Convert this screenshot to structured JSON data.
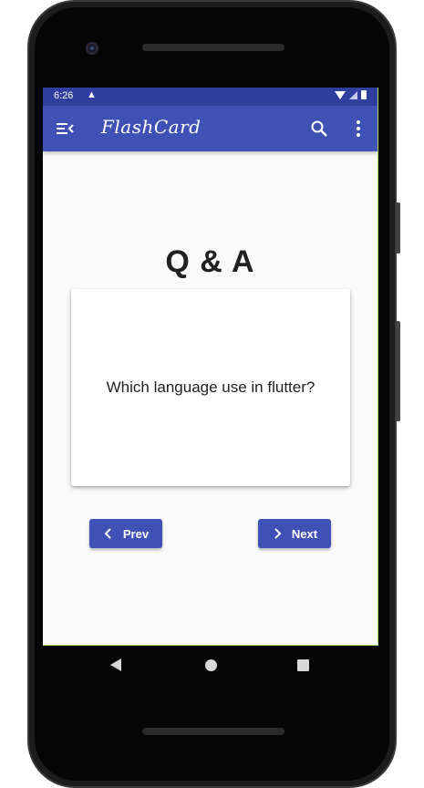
{
  "status_bar": {
    "time": "6:26",
    "warning_icon": "warning-icon",
    "wifi_icon": "wifi-icon",
    "signal_icon": "signal-icon",
    "battery_icon": "battery-icon"
  },
  "app_bar": {
    "title": "FlashCard",
    "menu_icon": "menu-open-icon",
    "search_icon": "search-icon",
    "more_icon": "more-vert-icon",
    "color": "#3f51b5",
    "status_color": "#303f9f"
  },
  "main": {
    "heading": "Q & A",
    "card": {
      "question": "Which language use in flutter?"
    },
    "buttons": {
      "prev_label": "Prev",
      "next_label": "Next"
    }
  },
  "system_nav": {
    "back_icon": "back-triangle-icon",
    "home_icon": "home-circle-icon",
    "recents_icon": "recents-square-icon"
  }
}
